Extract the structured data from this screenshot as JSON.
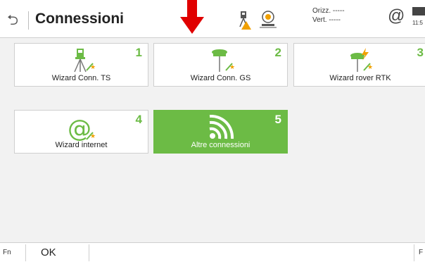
{
  "header": {
    "title": "Connessioni",
    "orizz_label": "Orizz. -----",
    "vert_label": "Vert.  -----",
    "clock": "11:5"
  },
  "tiles": [
    {
      "number": "1",
      "label": "Wizard Conn. TS",
      "icon": "total-station-wizard-icon"
    },
    {
      "number": "2",
      "label": "Wizard Conn. GS",
      "icon": "gnss-antenna-wizard-icon"
    },
    {
      "number": "3",
      "label": "Wizard rover RTK",
      "icon": "rtk-rover-wizard-icon"
    },
    {
      "number": "4",
      "label": "Wizard internet",
      "icon": "internet-at-wizard-icon"
    },
    {
      "number": "5",
      "label": "Altre connessioni",
      "icon": "wifi-icon"
    }
  ],
  "bottom": {
    "fn_left": "Fn",
    "ok_label": "OK",
    "fn_right": "F"
  },
  "colors": {
    "accent": "#6cbb45",
    "arrow": "#e00000",
    "warning": "#f0a000"
  }
}
